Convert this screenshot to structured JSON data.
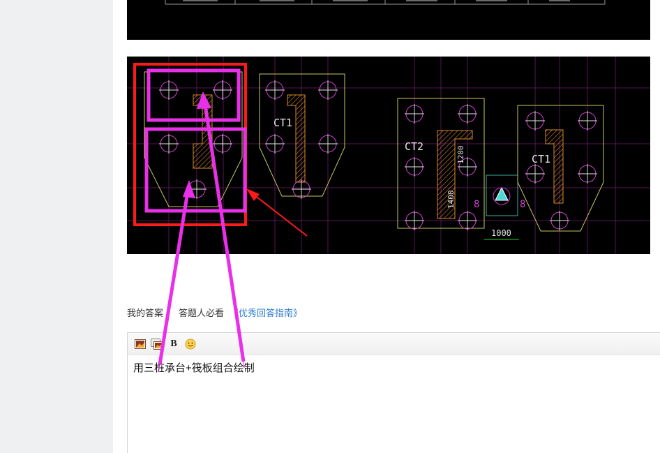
{
  "answer_bar": {
    "my_answer_label": "我的答案",
    "must_read_label": "答题人必看",
    "guide_link": "《优秀回答指南》"
  },
  "editor": {
    "toolbar": {
      "bold_label": "B",
      "icons": [
        "insert-image-icon",
        "insert-screenshot-icon",
        "bold-icon",
        "emoji-icon"
      ]
    },
    "content": "用三桩承台+筏板组合绘制"
  },
  "cad_image": {
    "labels": {
      "ct1_a": "CT1",
      "ct2": "CT2",
      "ct1_b": "CT1",
      "dim_1000": "1000",
      "dim_1400": "1400",
      "dim_1200": "1200",
      "mark_8a": "8",
      "mark_8b": "8"
    }
  },
  "colors": {
    "cad_background": "#000000",
    "cad_grid": "#cc2fcc",
    "cad_outline": "#c7c75e",
    "annotation_magenta": "#e830e8",
    "annotation_red": "#ff1a1a",
    "link_blue": "#2a7bd4",
    "page_gutter": "#eff0f2"
  }
}
